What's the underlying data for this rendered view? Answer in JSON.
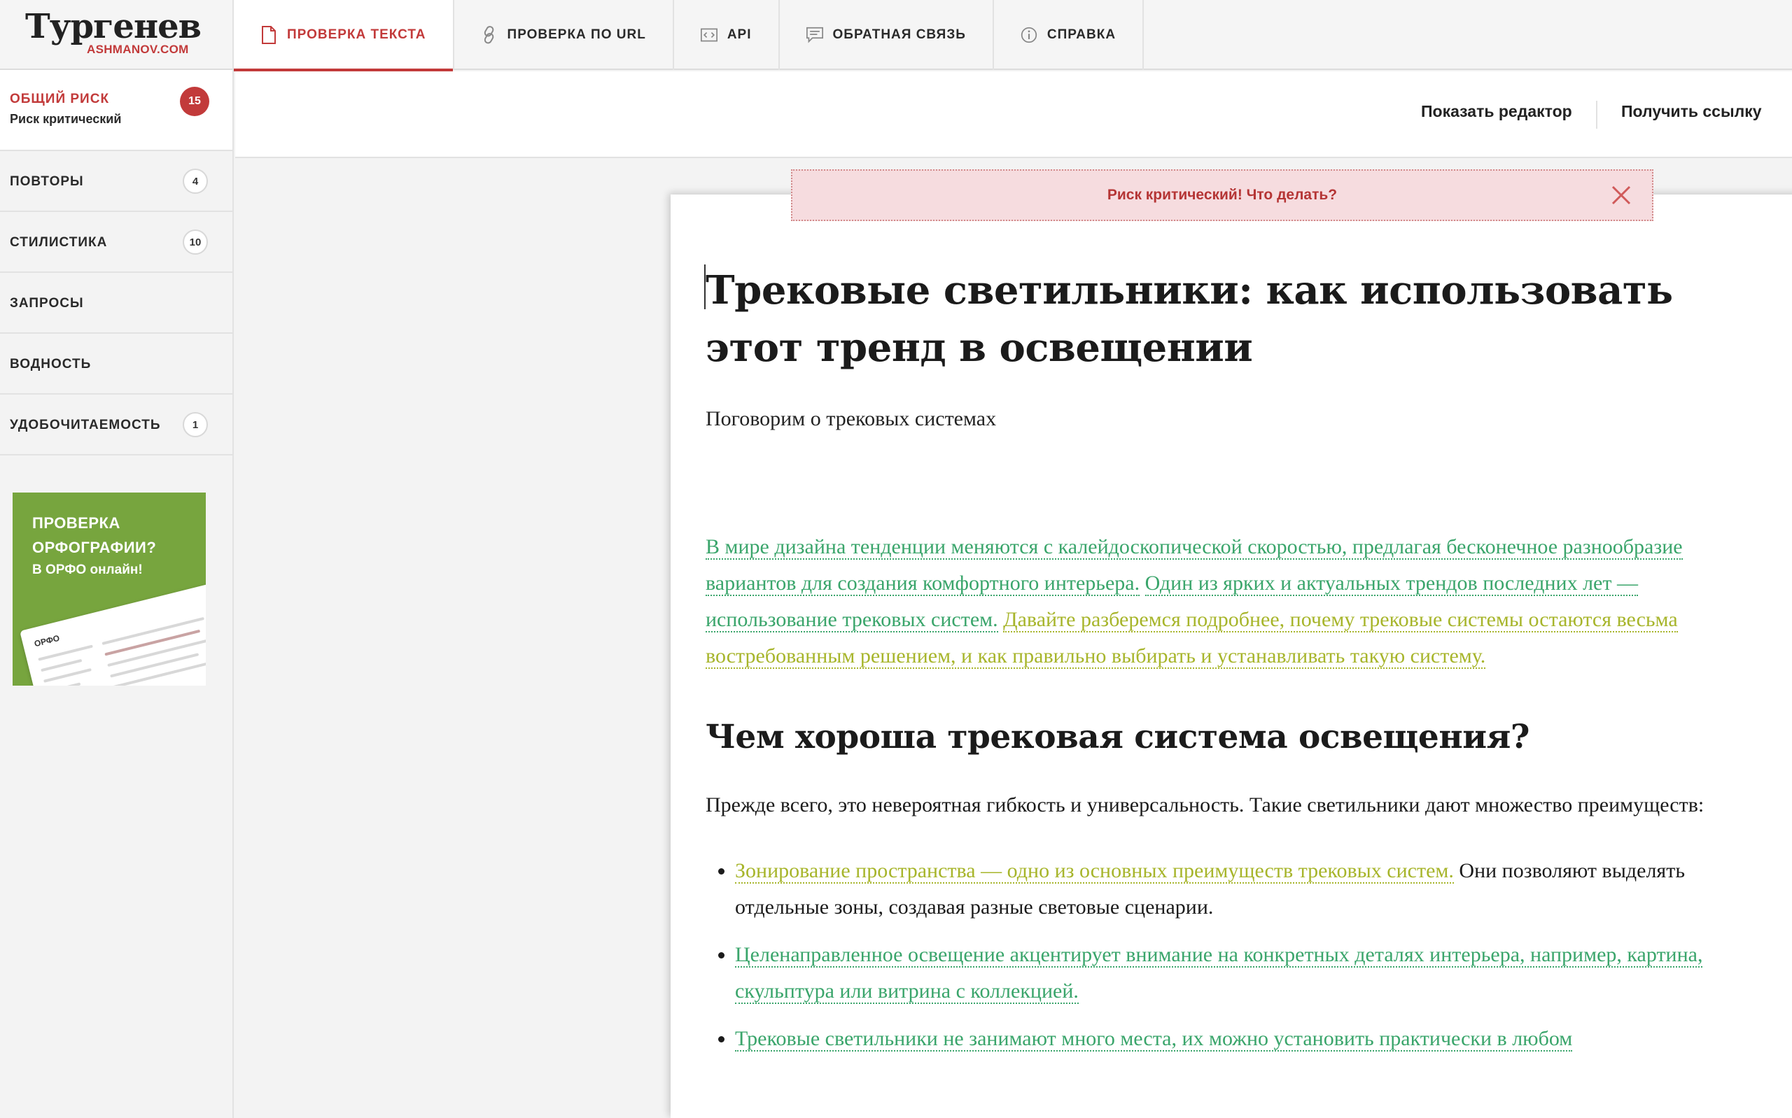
{
  "app": {
    "logo_title": "Тургенев",
    "logo_sub": "ASHMANOV.COM"
  },
  "tabs": [
    {
      "label": "ПРОВЕРКА ТЕКСТА",
      "icon": "document-icon",
      "active": true
    },
    {
      "label": "ПРОВЕРКА ПО URL",
      "icon": "link-icon",
      "active": false
    },
    {
      "label": "API",
      "icon": "code-icon",
      "active": false
    },
    {
      "label": "ОБРАТНАЯ СВЯЗЬ",
      "icon": "chat-icon",
      "active": false
    },
    {
      "label": "СПРАВКА",
      "icon": "info-icon",
      "active": false
    }
  ],
  "sidebar": {
    "risk": {
      "title": "ОБЩИЙ РИСК",
      "subtitle": "Риск критический",
      "score": "15"
    },
    "items": [
      {
        "label": "ПОВТОРЫ",
        "count": "4"
      },
      {
        "label": "СТИЛИСТИКА",
        "count": "10"
      },
      {
        "label": "ЗАПРОСЫ",
        "count": ""
      },
      {
        "label": "ВОДНОСТЬ",
        "count": ""
      },
      {
        "label": "УДОБОЧИТАЕМОСТЬ",
        "count": "1"
      }
    ],
    "ad": {
      "title": "ПРОВЕРКА ОРФОГРАФИИ?",
      "subtitle": "В ОРФО онлайн!",
      "brand": "ОРФО"
    }
  },
  "toolbar": {
    "show_editor": "Показать редактор",
    "get_link": "Получить ссылку"
  },
  "alert": {
    "text": "Риск критический! Что делать?"
  },
  "document": {
    "title": "Трековые светильники: как использовать этот тренд в освещении",
    "subtitle": "Поговорим о трековых системах",
    "p1_green_a": "В мире дизайна тенденции меняются с калейдоскопической скоростью, предлагая бесконечное разнообразие вариантов для создания комфортного интерьера.",
    "p1_green_b": "Один из ярких и актуальных трендов последних лет — использование трековых систем.",
    "p1_yellow": "Давайте разберемся подробнее, почему трековые системы остаются весьма востребованным решением, и как правильно выбирать и устанавливать такую систему.",
    "h2": "Чем хороша трековая система освещения?",
    "p2": "Прежде всего, это невероятная гибкость и универсальность. Такие светильники дают множество преимуществ:",
    "li1_yellow": "Зонирование пространства — одно из основных преимуществ трековых систем.",
    "li1_plain": "Они позволяют выделять отдельные зоны, создавая разные световые сценарии.",
    "li2_green": "Целенаправленное освещение акцентирует внимание на конкретных деталях интерьера, например, картина, скульптура или витрина с коллекцией.",
    "li3_green": "Трековые светильники не занимают много места, их можно установить практически в любом"
  },
  "colors": {
    "accent": "#c23a3a",
    "green_highlight": "#3aa56b",
    "yellow_highlight": "#a7b52b",
    "ad_background": "#77a53e"
  }
}
